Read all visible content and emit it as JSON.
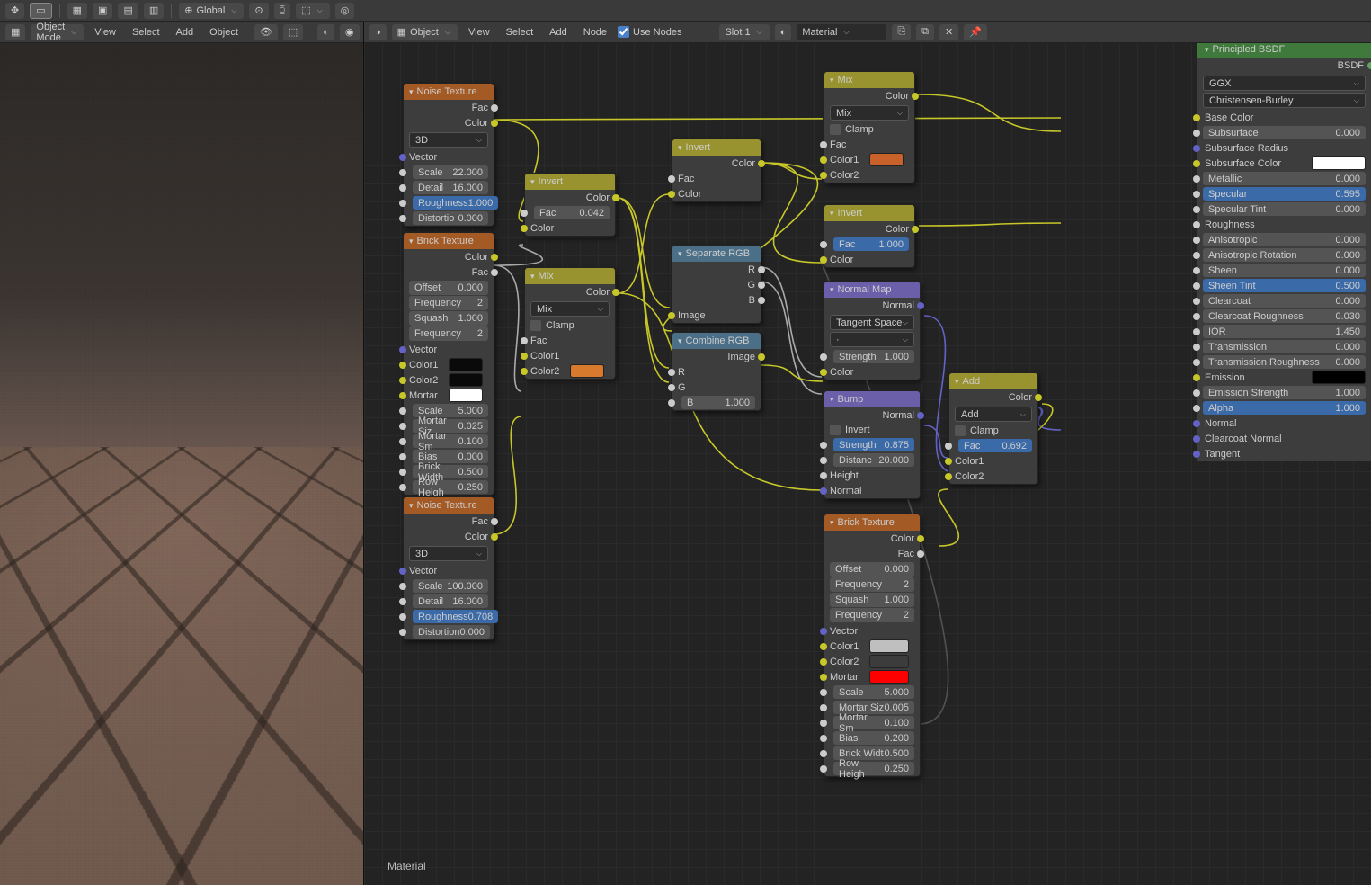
{
  "top": {
    "global": "Global",
    "object": "Object",
    "view": "View",
    "select": "Select",
    "add": "Add",
    "node": "Node",
    "useNodes": "Use Nodes",
    "slot": "Slot 1",
    "material": "Material",
    "objMode": "Object Mode",
    "view2": "View",
    "select2": "Select",
    "add2": "Add",
    "object2": "Object"
  },
  "matname": "Material",
  "nodes": {
    "noise1": {
      "title": "Noise Texture",
      "fac": "Fac",
      "color": "Color",
      "dim": "3D",
      "vector": "Vector",
      "scale_l": "Scale",
      "scale_v": "22.000",
      "detail_l": "Detail",
      "detail_v": "16.000",
      "rough_l": "Roughness",
      "rough_v": "1.000",
      "dist_l": "Distortio",
      "dist_v": "0.000"
    },
    "brick1": {
      "title": "Brick Texture",
      "color": "Color",
      "fac": "Fac",
      "off_l": "Offset",
      "off_v": "0.000",
      "freq_l": "Frequency",
      "freq_v": "2",
      "sq_l": "Squash",
      "sq_v": "1.000",
      "freq2_l": "Frequency",
      "freq2_v": "2",
      "vector": "Vector",
      "c1": "Color1",
      "c2": "Color2",
      "mortar": "Mortar",
      "sc_l": "Scale",
      "sc_v": "5.000",
      "ms_l": "Mortar Siz",
      "ms_v": "0.025",
      "msm_l": "Mortar Sm",
      "msm_v": "0.100",
      "bias_l": "Bias",
      "bias_v": "0.000",
      "bw_l": "Brick Width",
      "bw_v": "0.500",
      "rh_l": "Row Heigh",
      "rh_v": "0.250"
    },
    "noise2": {
      "title": "Noise Texture",
      "fac": "Fac",
      "color": "Color",
      "dim": "3D",
      "vector": "Vector",
      "scale_l": "Scale",
      "scale_v": "100.000",
      "detail_l": "Detail",
      "detail_v": "16.000",
      "rough_l": "Roughness",
      "rough_v": "0.708",
      "dist_l": "Distortion",
      "dist_v": "0.000"
    },
    "inv1": {
      "title": "Invert",
      "color": "Color",
      "fac_l": "Fac",
      "fac_v": "0.042",
      "cin": "Color"
    },
    "mix1": {
      "title": "Mix",
      "color": "Color",
      "mode": "Mix",
      "clamp": "Clamp",
      "fac": "Fac",
      "c1": "Color1",
      "c2": "Color2"
    },
    "inv2": {
      "title": "Invert",
      "color": "Color",
      "fac": "Fac",
      "cin": "Color"
    },
    "seprgb": {
      "title": "Separate RGB",
      "r": "R",
      "g": "G",
      "b": "B",
      "img": "Image"
    },
    "cmbrgb": {
      "title": "Combine RGB",
      "img": "Image",
      "r": "R",
      "g": "G",
      "b_l": "B",
      "b_v": "1.000"
    },
    "mix2": {
      "title": "Mix",
      "color": "Color",
      "mode": "Mix",
      "clamp": "Clamp",
      "fac": "Fac",
      "c1": "Color1",
      "c2": "Color2"
    },
    "inv3": {
      "title": "Invert",
      "color": "Color",
      "fac_l": "Fac",
      "fac_v": "1.000",
      "cin": "Color"
    },
    "nmap": {
      "title": "Normal Map",
      "normal": "Normal",
      "space": "Tangent Space",
      "uv": "·",
      "str_l": "Strength",
      "str_v": "1.000",
      "color": "Color"
    },
    "bump": {
      "title": "Bump",
      "normal": "Normal",
      "inv": "Invert",
      "str_l": "Strength",
      "str_v": "0.875",
      "dist_l": "Distanc",
      "dist_v": "20.000",
      "height": "Height",
      "nin": "Normal"
    },
    "brick2": {
      "title": "Brick Texture",
      "color": "Color",
      "fac": "Fac",
      "off_l": "Offset",
      "off_v": "0.000",
      "freq_l": "Frequency",
      "freq_v": "2",
      "sq_l": "Squash",
      "sq_v": "1.000",
      "freq2_l": "Frequency",
      "freq2_v": "2",
      "vector": "Vector",
      "c1": "Color1",
      "c2": "Color2",
      "mortar": "Mortar",
      "sc_l": "Scale",
      "sc_v": "5.000",
      "ms_l": "Mortar Siz",
      "ms_v": "0.005",
      "msm_l": "Mortar Sm",
      "msm_v": "0.100",
      "bias_l": "Bias",
      "bias_v": "0.200",
      "bw_l": "Brick Widt",
      "bw_v": "0.500",
      "rh_l": "Row Heigh",
      "rh_v": "0.250"
    },
    "add": {
      "title": "Add",
      "color": "Color",
      "mode": "Add",
      "clamp": "Clamp",
      "fac_l": "Fac",
      "fac_v": "0.692",
      "c1": "Color1",
      "c2": "Color2"
    }
  },
  "pr": {
    "title": "Principled BSDF",
    "out": "BSDF",
    "ggx": "GGX",
    "sss": "Christensen-Burley",
    "base": "Base Color",
    "sub_l": "Subsurface",
    "sub_v": "0.000",
    "subr": "Subsurface Radius",
    "subc": "Subsurface Color",
    "met_l": "Metallic",
    "met_v": "0.000",
    "spec_l": "Specular",
    "spec_v": "0.595",
    "spt_l": "Specular Tint",
    "spt_v": "0.000",
    "rough": "Roughness",
    "ani_l": "Anisotropic",
    "ani_v": "0.000",
    "anir_l": "Anisotropic Rotation",
    "anir_v": "0.000",
    "sheen_l": "Sheen",
    "sheen_v": "0.000",
    "sht_l": "Sheen Tint",
    "sht_v": "0.500",
    "cc_l": "Clearcoat",
    "cc_v": "0.000",
    "ccr_l": "Clearcoat Roughness",
    "ccr_v": "0.030",
    "ior_l": "IOR",
    "ior_v": "1.450",
    "tr_l": "Transmission",
    "tr_v": "0.000",
    "trr_l": "Transmission Roughness",
    "trr_v": "0.000",
    "em": "Emission",
    "ems_l": "Emission Strength",
    "ems_v": "1.000",
    "al_l": "Alpha",
    "al_v": "1.000",
    "norm": "Normal",
    "ccn": "Clearcoat Normal",
    "tan": "Tangent"
  }
}
